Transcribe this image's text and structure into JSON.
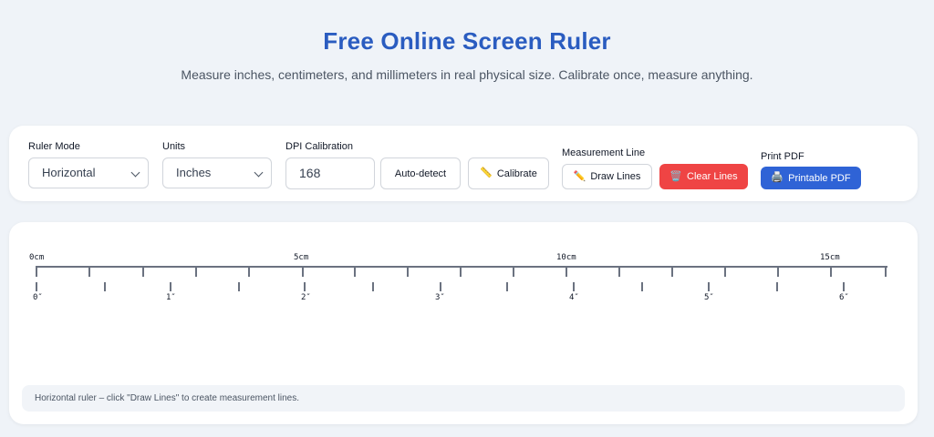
{
  "header": {
    "title": "Free Online Screen Ruler",
    "subtitle": "Measure inches, centimeters, and millimeters in real physical size. Calibrate once, measure anything."
  },
  "controls": {
    "ruler_mode": {
      "label": "Ruler Mode",
      "value": "Horizontal"
    },
    "units": {
      "label": "Units",
      "value": "Inches"
    },
    "dpi": {
      "label": "DPI Calibration",
      "value": "168"
    },
    "auto_detect_label": "Auto-detect",
    "calibrate_label": "Calibrate",
    "measurement_line": {
      "label": "Measurement Line",
      "draw_label": "Draw Lines",
      "clear_label": "Clear Lines"
    },
    "print_pdf": {
      "label": "Print PDF",
      "button_label": "Printable PDF"
    }
  },
  "icons": {
    "calibrate": "ruler-icon",
    "draw": "pencil-icon",
    "clear": "trash-icon",
    "print": "printer-icon"
  },
  "colors": {
    "title": "#2a5cc0",
    "accent_blue": "#2f63d6",
    "danger_red": "#ef4444",
    "ruler_line": "#6b7280"
  },
  "ruler": {
    "cm_labels": [
      "0cm",
      "5cm",
      "10cm",
      "15cm"
    ],
    "inch_labels": [
      "0″",
      "1″",
      "2″",
      "3″",
      "4″",
      "5″",
      "6″"
    ]
  },
  "status": {
    "text": "Horizontal ruler – click \"Draw Lines\" to create measurement lines."
  }
}
